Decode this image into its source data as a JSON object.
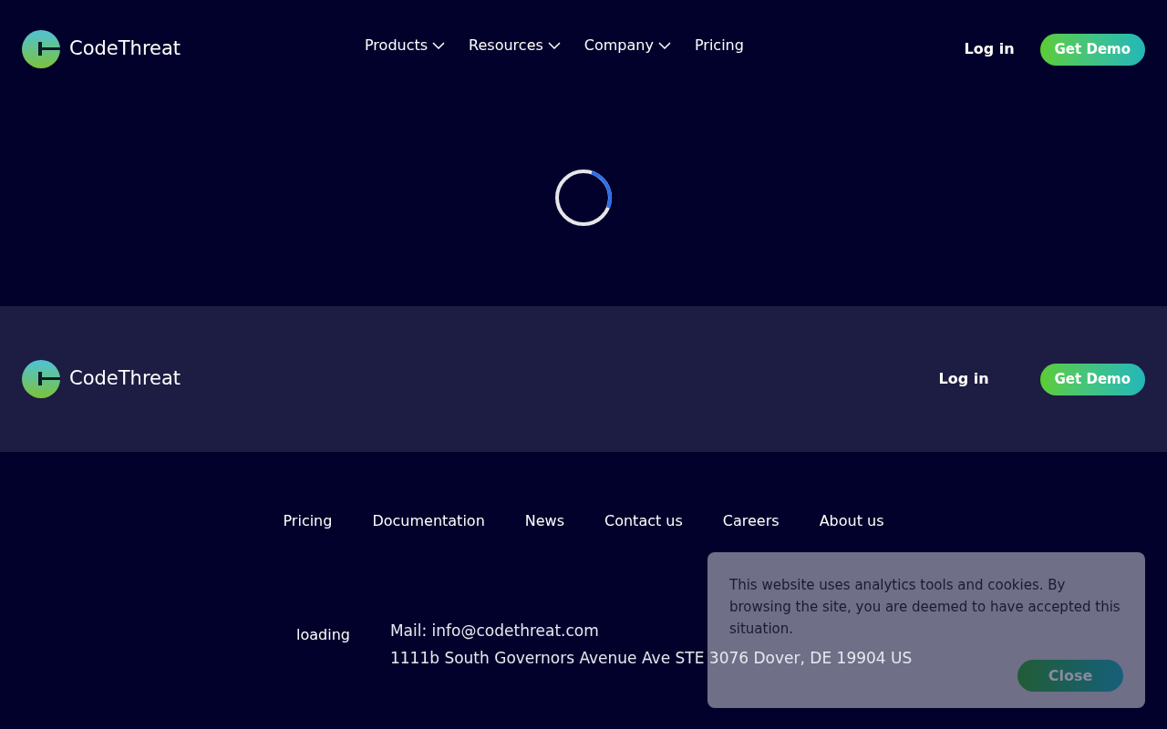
{
  "header": {
    "brand": "CodeThreat",
    "nav": [
      {
        "label": "Products",
        "dropdown": true
      },
      {
        "label": "Resources",
        "dropdown": true
      },
      {
        "label": "Company",
        "dropdown": true
      },
      {
        "label": "Pricing",
        "dropdown": false
      }
    ],
    "login": "Log in",
    "cta": "Get Demo"
  },
  "cta_band": {
    "brand": "CodeThreat",
    "login": "Log in",
    "cta": "Get Demo"
  },
  "footer": {
    "links": [
      "Pricing",
      "Documentation",
      "News",
      "Contact us",
      "Careers",
      "About us"
    ],
    "loading": "loading",
    "mail": "Mail: info@codethreat.com",
    "address": "1111b South Governors Avenue Ave STE 3076 Dover, DE 19904 US"
  },
  "cookie_banner": {
    "message": "This website uses analytics tools and cookies. By browsing the site, you are deemed to have accepted this situation.",
    "button": "Close"
  }
}
